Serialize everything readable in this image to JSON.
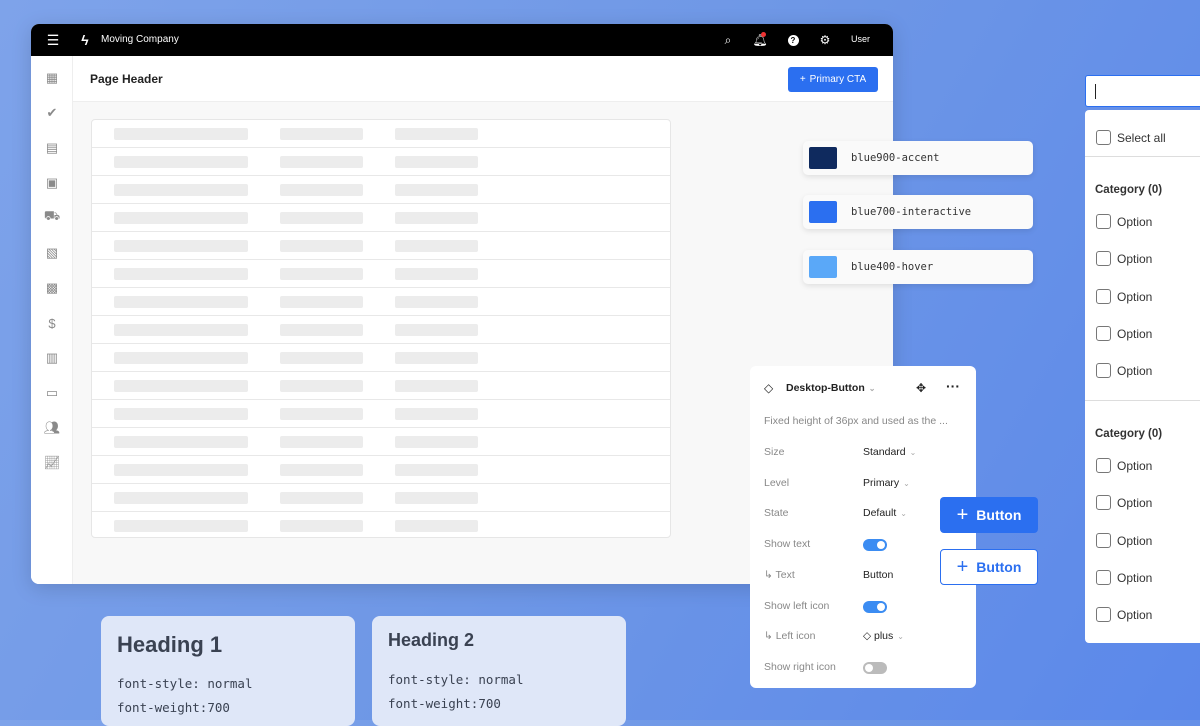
{
  "app": {
    "title": "Moving Company",
    "user": "User",
    "page_header": "Page Header",
    "cta": "Primary CTA"
  },
  "colors": {
    "accent": "#0f2a5e",
    "interactive": "#2b6ff0",
    "hover": "#5aa8f8"
  },
  "swatches": [
    {
      "label": "blue900-accent",
      "color": "#0f2a5e"
    },
    {
      "label": "blue700-interactive",
      "color": "#2b6ff0"
    },
    {
      "label": "blue400-hover",
      "color": "#5aa8f8"
    }
  ],
  "props": {
    "title": "Desktop-Button",
    "description": "Fixed height of 36px and used as the ...",
    "rows": [
      {
        "label": "Size",
        "value": "Standard"
      },
      {
        "label": "Level",
        "value": "Primary"
      },
      {
        "label": "State",
        "value": "Default"
      },
      {
        "label": "Show text",
        "toggle": true
      },
      {
        "label": "↳ Text",
        "value": "Button"
      },
      {
        "label": "Show left icon",
        "toggle": true
      },
      {
        "label": "↳ Left icon",
        "value": "plus"
      },
      {
        "label": "Show right icon",
        "toggle": false
      }
    ]
  },
  "buttons": {
    "primary": "Button",
    "secondary": "Button"
  },
  "filter": {
    "select_all": "Select all",
    "groups": [
      {
        "title": "Category (0)",
        "options": [
          "Option",
          "Option",
          "Option",
          "Option",
          "Option"
        ]
      },
      {
        "title": "Category (0)",
        "options": [
          "Option",
          "Option",
          "Option",
          "Option",
          "Option"
        ]
      }
    ]
  },
  "headings": [
    {
      "title": "Heading 1",
      "style_label": "font-style:",
      "style": "normal",
      "weight_label": "font-weight:",
      "weight": "700"
    },
    {
      "title": "Heading 2",
      "style_label": "font-style:",
      "style": "normal",
      "weight_label": "font-weight:",
      "weight": "700"
    }
  ]
}
